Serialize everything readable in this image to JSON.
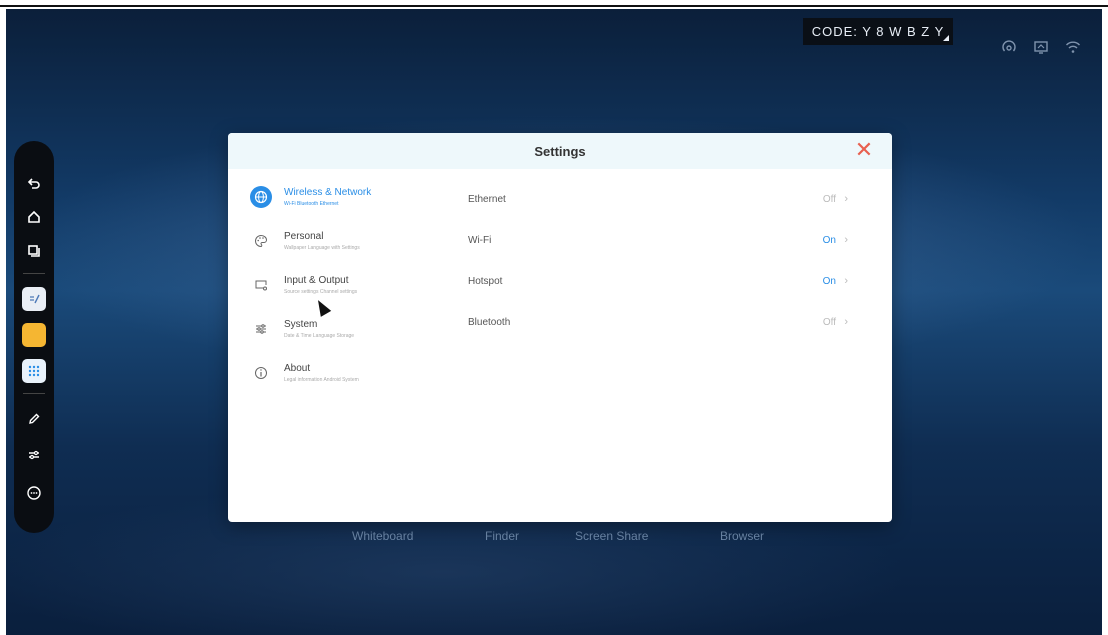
{
  "status_bar": {
    "code_text": "CODE: Y 8 W B Z Y",
    "icons": [
      "hotspot-icon",
      "screen-share-icon",
      "wifi-icon"
    ]
  },
  "toolbar": {
    "items": [
      "back-icon",
      "home-icon",
      "windows-icon",
      "note-icon",
      "sticky-icon",
      "apps-icon",
      "pen-icon",
      "adjust-icon",
      "more-icon"
    ]
  },
  "dock": {
    "labels": [
      "Whiteboard",
      "Finder",
      "Screen Share",
      "Browser"
    ]
  },
  "dialog": {
    "title": "Settings",
    "nav": [
      {
        "label": "Wireless & Network",
        "sub": "Wi-Fi Bluetooth Ethernet",
        "icon": "globe-icon",
        "active": true
      },
      {
        "label": "Personal",
        "sub": "Wallpaper Language with Settings",
        "icon": "palette-icon",
        "active": false
      },
      {
        "label": "Input & Output",
        "sub": "Source settings Channel settings",
        "icon": "input-output-icon",
        "active": false
      },
      {
        "label": "System",
        "sub": "Date & Time Language Storage",
        "icon": "sliders-icon",
        "active": false
      },
      {
        "label": "About",
        "sub": "Legal information Android System",
        "icon": "info-icon",
        "active": false
      }
    ],
    "rows": [
      {
        "label": "Ethernet",
        "value": "Off",
        "on": false
      },
      {
        "label": "Wi-Fi",
        "value": "On",
        "on": true
      },
      {
        "label": "Hotspot",
        "value": "On",
        "on": true
      },
      {
        "label": "Bluetooth",
        "value": "Off",
        "on": false
      }
    ]
  },
  "colors": {
    "accent": "#2a8ee6",
    "close": "#e8604f",
    "header_bg": "#eef8fb"
  }
}
